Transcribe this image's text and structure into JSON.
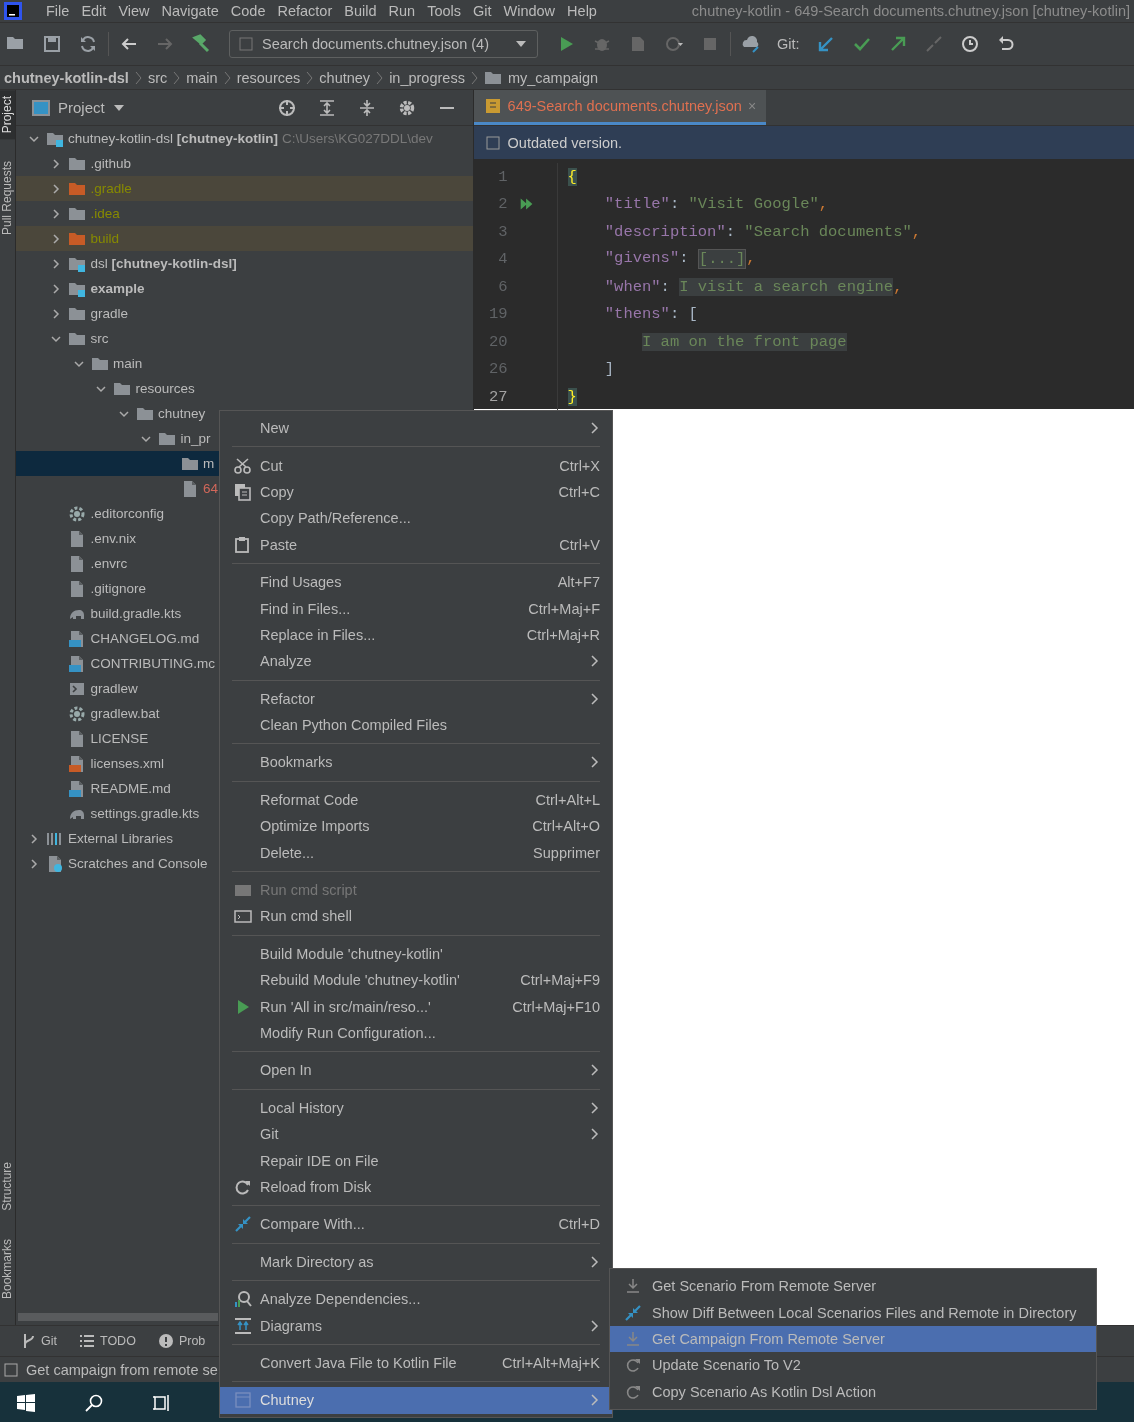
{
  "menu_bar": {
    "items": [
      "File",
      "Edit",
      "View",
      "Navigate",
      "Code",
      "Refactor",
      "Build",
      "Run",
      "Tools",
      "Git",
      "Window",
      "Help"
    ],
    "title": "chutney-kotlin - 649-Search documents.chutney.json [chutney-kotlin]"
  },
  "toolbar": {
    "run_config": "Search documents.chutney.json (4)",
    "git_label": "Git:"
  },
  "breadcrumbs": [
    {
      "label": "chutney-kotlin-dsl",
      "bold": true
    },
    {
      "label": "src",
      "bold": false
    },
    {
      "label": "main",
      "bold": false
    },
    {
      "label": "resources",
      "bold": false
    },
    {
      "label": "chutney",
      "bold": false
    },
    {
      "label": "in_progress",
      "bold": false
    },
    {
      "label": "my_campaign",
      "bold": false
    }
  ],
  "side_stripe": {
    "top": [
      {
        "label": "Project",
        "selected": true
      },
      {
        "label": "Pull Requests",
        "selected": false
      }
    ],
    "bottom": [
      {
        "label": "Structure",
        "selected": false
      },
      {
        "label": "Bookmarks",
        "selected": false
      }
    ]
  },
  "project_panel": {
    "title": "Project",
    "tree": [
      {
        "label": "chutney-kotlin-dsl **[chutney-kotlin]**",
        "path": "C:\\Users\\KG027DDL\\dev",
        "kind": "module",
        "bold": false,
        "expanded": true,
        "selected": false,
        "unversioned": false,
        "children": [
          {
            "label": ".github",
            "kind": "folder",
            "bold": false,
            "expanded": false,
            "selected": false,
            "unversioned": false
          },
          {
            "label": ".gradle",
            "kind": "excluded",
            "bold": false,
            "expanded": false,
            "selected": false,
            "unversioned": false
          },
          {
            "label": ".idea",
            "kind": "ignored",
            "bold": false,
            "expanded": false,
            "selected": false,
            "unversioned": false
          },
          {
            "label": "build",
            "kind": "excluded",
            "bold": false,
            "expanded": false,
            "selected": false,
            "unversioned": false
          },
          {
            "label": "dsl **[chutney-kotlin-dsl]**",
            "kind": "module",
            "bold": false,
            "expanded": false,
            "selected": false,
            "unversioned": false
          },
          {
            "label": "example",
            "kind": "module",
            "bold": true,
            "expanded": false,
            "selected": false,
            "unversioned": false
          },
          {
            "label": "gradle",
            "kind": "folder",
            "bold": false,
            "expanded": false,
            "selected": false,
            "unversioned": false
          },
          {
            "label": "src",
            "kind": "folder",
            "bold": false,
            "expanded": true,
            "selected": false,
            "unversioned": false,
            "children": [
              {
                "label": "main",
                "kind": "folder",
                "bold": false,
                "expanded": true,
                "selected": false,
                "unversioned": false,
                "children": [
                  {
                    "label": "resources",
                    "kind": "folder",
                    "bold": false,
                    "expanded": true,
                    "selected": false,
                    "unversioned": false,
                    "children": [
                      {
                        "label": "chutney",
                        "kind": "folder",
                        "bold": false,
                        "expanded": true,
                        "selected": false,
                        "unversioned": false,
                        "children": [
                          {
                            "label": "in_pr",
                            "kind": "folder",
                            "bold": false,
                            "expanded": true,
                            "selected": false,
                            "unversioned": false,
                            "children": [
                              {
                                "label": "m",
                                "kind": "folder",
                                "bold": false,
                                "selected": true,
                                "unversioned": false
                              },
                              {
                                "label": "64",
                                "kind": "file",
                                "bold": false,
                                "selected": false,
                                "unversioned": true
                              }
                            ]
                          }
                        ]
                      }
                    ]
                  }
                ]
              }
            ]
          },
          {
            "label": ".editorconfig",
            "kind": "settings",
            "bold": false,
            "selected": false,
            "unversioned": false
          },
          {
            "label": ".env.nix",
            "kind": "file",
            "bold": false,
            "selected": false,
            "unversioned": false
          },
          {
            "label": ".envrc",
            "kind": "file",
            "bold": false,
            "selected": false,
            "unversioned": false
          },
          {
            "label": ".gitignore",
            "kind": "file",
            "bold": false,
            "selected": false,
            "unversioned": false
          },
          {
            "label": "build.gradle.kts",
            "kind": "gradle",
            "bold": false,
            "selected": false,
            "unversioned": false
          },
          {
            "label": "CHANGELOG.md",
            "kind": "markdown",
            "bold": false,
            "selected": false,
            "unversioned": false
          },
          {
            "label": "CONTRIBUTING.mc",
            "kind": "markdown",
            "bold": false,
            "selected": false,
            "unversioned": false
          },
          {
            "label": "gradlew",
            "kind": "script",
            "bold": false,
            "selected": false,
            "unversioned": false
          },
          {
            "label": "gradlew.bat",
            "kind": "settings",
            "bold": false,
            "selected": false,
            "unversioned": false
          },
          {
            "label": "LICENSE",
            "kind": "file",
            "bold": false,
            "selected": false,
            "unversioned": false
          },
          {
            "label": "licenses.xml",
            "kind": "xml",
            "bold": false,
            "selected": false,
            "unversioned": false
          },
          {
            "label": "README.md",
            "kind": "markdown",
            "bold": false,
            "selected": false,
            "unversioned": false
          },
          {
            "label": "settings.gradle.kts",
            "kind": "gradle",
            "bold": false,
            "selected": false,
            "unversioned": false
          }
        ]
      },
      {
        "label": "External Libraries",
        "kind": "library",
        "bold": false,
        "expanded": false,
        "selected": false,
        "unversioned": false
      },
      {
        "label": "Scratches and Console",
        "kind": "scratch",
        "bold": false,
        "expanded": false,
        "selected": false,
        "unversioned": false
      }
    ]
  },
  "editor": {
    "tab": "649-Search documents.chutney.json",
    "tab_close": "×",
    "notice": "Outdated version.",
    "lines": [
      {
        "number": "1",
        "current": false,
        "run": false,
        "segments": [
          {
            "kind": "brace",
            "text": "{"
          }
        ]
      },
      {
        "number": "2",
        "current": false,
        "run": true,
        "segments": [
          {
            "kind": "key",
            "text": "    \"title\""
          },
          {
            "kind": "plain",
            "text": ": "
          },
          {
            "kind": "string",
            "text": "\"Visit Google\""
          },
          {
            "kind": "comma",
            "text": ","
          }
        ]
      },
      {
        "number": "3",
        "current": false,
        "run": false,
        "segments": [
          {
            "kind": "key",
            "text": "    \"description\""
          },
          {
            "kind": "plain",
            "text": ": "
          },
          {
            "kind": "string",
            "text": "\"Search documents\""
          },
          {
            "kind": "comma",
            "text": ","
          }
        ]
      },
      {
        "number": "4",
        "current": false,
        "run": false,
        "segments": [
          {
            "kind": "key",
            "text": "    \"givens\""
          },
          {
            "kind": "plain",
            "text": ": "
          },
          {
            "kind": "fold",
            "text": "[...]"
          },
          {
            "kind": "comma",
            "text": ","
          }
        ]
      },
      {
        "number": "6",
        "current": false,
        "run": false,
        "segments": [
          {
            "kind": "key",
            "text": "    \"when\""
          },
          {
            "kind": "plain",
            "text": ": "
          },
          {
            "kind": "folded",
            "text": "I visit a search engine"
          },
          {
            "kind": "comma",
            "text": ","
          }
        ]
      },
      {
        "number": "19",
        "current": false,
        "run": false,
        "segments": [
          {
            "kind": "key",
            "text": "    \"thens\""
          },
          {
            "kind": "plain",
            "text": ": ["
          }
        ]
      },
      {
        "number": "20",
        "current": false,
        "run": false,
        "segments": [
          {
            "kind": "folded",
            "text": "        I am on the front page"
          }
        ]
      },
      {
        "number": "26",
        "current": false,
        "run": false,
        "segments": [
          {
            "kind": "plain",
            "text": "    ]"
          }
        ]
      },
      {
        "number": "27",
        "current": true,
        "run": false,
        "segments": [
          {
            "kind": "brace",
            "text": "}"
          }
        ]
      }
    ]
  },
  "context_menu": {
    "groups": [
      [
        {
          "label": "New",
          "submenu": true,
          "disabled": false,
          "selected": false
        }
      ],
      [
        {
          "label": "Cut",
          "shortcut": "Ctrl+X",
          "submenu": false,
          "disabled": false,
          "selected": false
        },
        {
          "label": "Copy",
          "shortcut": "Ctrl+C",
          "submenu": false,
          "disabled": false,
          "selected": false
        },
        {
          "label": "Copy Path/Reference...",
          "submenu": false,
          "disabled": false,
          "selected": false
        },
        {
          "label": "Paste",
          "shortcut": "Ctrl+V",
          "submenu": false,
          "disabled": false,
          "selected": false
        }
      ],
      [
        {
          "label": "Find Usages",
          "shortcut": "Alt+F7",
          "submenu": false,
          "disabled": false,
          "selected": false
        },
        {
          "label": "Find in Files...",
          "shortcut": "Ctrl+Maj+F",
          "submenu": false,
          "disabled": false,
          "selected": false
        },
        {
          "label": "Replace in Files...",
          "shortcut": "Ctrl+Maj+R",
          "submenu": false,
          "disabled": false,
          "selected": false
        },
        {
          "label": "Analyze",
          "submenu": true,
          "disabled": false,
          "selected": false
        }
      ],
      [
        {
          "label": "Refactor",
          "submenu": true,
          "disabled": false,
          "selected": false
        },
        {
          "label": "Clean Python Compiled Files",
          "submenu": false,
          "disabled": false,
          "selected": false
        }
      ],
      [
        {
          "label": "Bookmarks",
          "submenu": true,
          "disabled": false,
          "selected": false
        }
      ],
      [
        {
          "label": "Reformat Code",
          "shortcut": "Ctrl+Alt+L",
          "submenu": false,
          "disabled": false,
          "selected": false
        },
        {
          "label": "Optimize Imports",
          "shortcut": "Ctrl+Alt+O",
          "submenu": false,
          "disabled": false,
          "selected": false
        },
        {
          "label": "Delete...",
          "shortcut": "Supprimer",
          "submenu": false,
          "disabled": false,
          "selected": false
        }
      ],
      [
        {
          "label": "Run cmd script",
          "submenu": false,
          "disabled": true,
          "selected": false
        },
        {
          "label": "Run cmd shell",
          "submenu": false,
          "disabled": false,
          "selected": false
        }
      ],
      [
        {
          "label": "Build Module 'chutney-kotlin'",
          "submenu": false,
          "disabled": false,
          "selected": false
        },
        {
          "label": "Rebuild Module 'chutney-kotlin'",
          "shortcut": "Ctrl+Maj+F9",
          "submenu": false,
          "disabled": false,
          "selected": false
        },
        {
          "label": "Run 'All in src/main/reso...'",
          "shortcut": "Ctrl+Maj+F10",
          "submenu": false,
          "disabled": false,
          "selected": false
        },
        {
          "label": "Modify Run Configuration...",
          "submenu": false,
          "disabled": false,
          "selected": false
        }
      ],
      [
        {
          "label": "Open In",
          "submenu": true,
          "disabled": false,
          "selected": false
        }
      ],
      [
        {
          "label": "Local History",
          "submenu": true,
          "disabled": false,
          "selected": false
        },
        {
          "label": "Git",
          "submenu": true,
          "disabled": false,
          "selected": false
        },
        {
          "label": "Repair IDE on File",
          "submenu": false,
          "disabled": false,
          "selected": false
        },
        {
          "label": "Reload from Disk",
          "submenu": false,
          "disabled": false,
          "selected": false
        }
      ],
      [
        {
          "label": "Compare With...",
          "shortcut": "Ctrl+D",
          "submenu": false,
          "disabled": false,
          "selected": false
        }
      ],
      [
        {
          "label": "Mark Directory as",
          "submenu": true,
          "disabled": false,
          "selected": false
        }
      ],
      [
        {
          "label": "Analyze Dependencies...",
          "submenu": false,
          "disabled": false,
          "selected": false
        },
        {
          "label": "Diagrams",
          "submenu": true,
          "disabled": false,
          "selected": false
        }
      ],
      [
        {
          "label": "Convert Java File to Kotlin File",
          "shortcut": "Ctrl+Alt+Maj+K",
          "submenu": false,
          "disabled": false,
          "selected": false
        }
      ],
      [
        {
          "label": "Chutney",
          "submenu": true,
          "disabled": false,
          "selected": true
        }
      ]
    ]
  },
  "submenu": {
    "items": [
      {
        "label": "Get Scenario From Remote Server",
        "selected": false
      },
      {
        "label": "Show Diff Between Local Scenarios Files and Remote in Directory",
        "selected": false
      },
      {
        "label": "Get Campaign From Remote Server",
        "selected": true
      },
      {
        "label": "Update Scenario To V2",
        "selected": false
      },
      {
        "label": "Copy Scenario As Kotlin Dsl Action",
        "selected": false
      }
    ]
  },
  "tool_windows": [
    "Git",
    "TODO",
    "Prob"
  ],
  "status_bar": {
    "message": "Get campaign from remote se"
  }
}
